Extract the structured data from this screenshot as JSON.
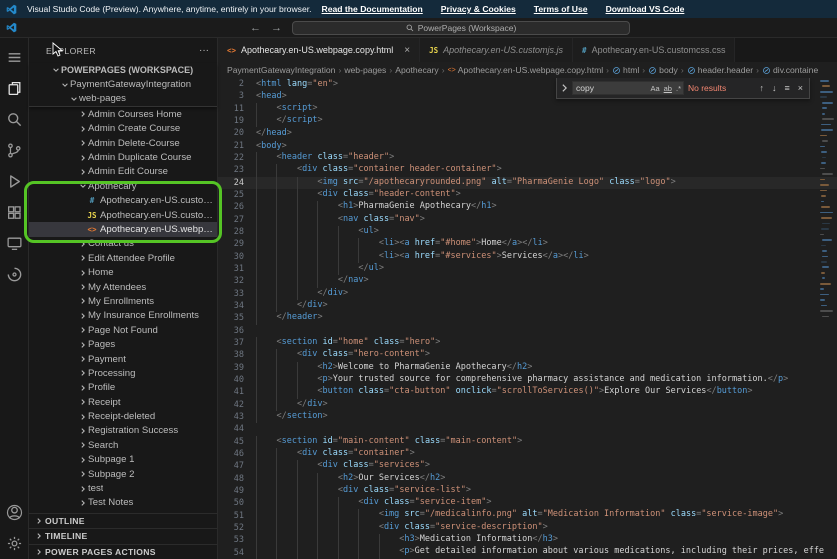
{
  "banner": {
    "text": "Visual Studio Code (Preview). Anywhere, anytime, entirely in your browser.",
    "links": [
      "Read the Documentation",
      "Privacy & Cookies",
      "Terms of Use",
      "Download VS Code"
    ]
  },
  "titlebar": {
    "search_label": "PowerPages (Workspace)",
    "back": "←",
    "forward": "→"
  },
  "activitybar": {
    "icons": [
      "menu-icon",
      "explorer-icon",
      "search-icon",
      "source-control-icon",
      "run-debug-icon",
      "extensions-icon",
      "remote-explorer-icon",
      "power-platform-icon"
    ],
    "bottom_icons": [
      "account-icon",
      "settings-gear-icon"
    ],
    "active": "explorer-icon"
  },
  "sidebar": {
    "title": "EXPLORER",
    "actions_label": "···",
    "sticky": [
      {
        "label": "POWERPAGES (WORKSPACE)",
        "level": 0,
        "expanded": true,
        "bold": true
      },
      {
        "label": "PaymentGatewayIntegration",
        "level": 1,
        "expanded": true
      },
      {
        "label": "web-pages",
        "level": 2,
        "expanded": true
      }
    ],
    "items": [
      {
        "label": "Admin Courses Home",
        "level": 3,
        "kind": "folder"
      },
      {
        "label": "Admin Create Course",
        "level": 3,
        "kind": "folder"
      },
      {
        "label": "Admin Delete-Course",
        "level": 3,
        "kind": "folder"
      },
      {
        "label": "Admin Duplicate Course",
        "level": 3,
        "kind": "folder"
      },
      {
        "label": "Admin Edit Course",
        "level": 3,
        "kind": "folder"
      },
      {
        "label": "Apothecary",
        "level": 3,
        "kind": "folder",
        "expanded": true
      },
      {
        "label": "Apothecary.en-US.customcss.css",
        "level": 4,
        "kind": "css"
      },
      {
        "label": "Apothecary.en-US.customjs.js",
        "level": 4,
        "kind": "js"
      },
      {
        "label": "Apothecary.en-US.webpage.copy.html",
        "level": 4,
        "kind": "html",
        "selected": true
      },
      {
        "label": "Contact us",
        "level": 3,
        "kind": "folder"
      },
      {
        "label": "Edit Attendee Profile",
        "level": 3,
        "kind": "folder"
      },
      {
        "label": "Home",
        "level": 3,
        "kind": "folder"
      },
      {
        "label": "My Attendees",
        "level": 3,
        "kind": "folder"
      },
      {
        "label": "My Enrollments",
        "level": 3,
        "kind": "folder"
      },
      {
        "label": "My Insurance Enrollments",
        "level": 3,
        "kind": "folder"
      },
      {
        "label": "Page Not Found",
        "level": 3,
        "kind": "folder"
      },
      {
        "label": "Pages",
        "level": 3,
        "kind": "folder"
      },
      {
        "label": "Payment",
        "level": 3,
        "kind": "folder"
      },
      {
        "label": "Processing",
        "level": 3,
        "kind": "folder"
      },
      {
        "label": "Profile",
        "level": 3,
        "kind": "folder"
      },
      {
        "label": "Receipt",
        "level": 3,
        "kind": "folder"
      },
      {
        "label": "Receipt-deleted",
        "level": 3,
        "kind": "folder"
      },
      {
        "label": "Registration Success",
        "level": 3,
        "kind": "folder"
      },
      {
        "label": "Search",
        "level": 3,
        "kind": "folder"
      },
      {
        "label": "Subpage 1",
        "level": 3,
        "kind": "folder"
      },
      {
        "label": "Subpage 2",
        "level": 3,
        "kind": "folder"
      },
      {
        "label": "test",
        "level": 3,
        "kind": "folder"
      },
      {
        "label": "Test Notes",
        "level": 3,
        "kind": "folder"
      }
    ],
    "panels": [
      "OUTLINE",
      "TIMELINE",
      "POWER PAGES ACTIONS"
    ]
  },
  "tabs": [
    {
      "label": "Apothecary.en-US.webpage.copy.html",
      "icon": "html",
      "active": true,
      "close_label": "×"
    },
    {
      "label": "Apothecary.en-US.customjs.js",
      "icon": "js",
      "preview": true
    },
    {
      "label": "Apothecary.en-US.customcss.css",
      "icon": "css"
    }
  ],
  "breadcrumbs": [
    {
      "label": "PaymentGatewayIntegration"
    },
    {
      "label": "web-pages"
    },
    {
      "label": "Apothecary"
    },
    {
      "label": "Apothecary.en-US.webpage.copy.html",
      "icon": "html"
    },
    {
      "label": "html",
      "icon": "symbol"
    },
    {
      "label": "body",
      "icon": "symbol"
    },
    {
      "label": "header.header",
      "icon": "symbol"
    },
    {
      "label": "div.containe",
      "icon": "symbol"
    }
  ],
  "find": {
    "query": "copy",
    "status": "No results",
    "options": [
      "Aa",
      "ab",
      ".*"
    ],
    "buttons": [
      "↑",
      "↓",
      "≡",
      "×"
    ]
  },
  "editor": {
    "active_line": 24,
    "lines": [
      {
        "n": 2,
        "t": "<html lang=\"en\">"
      },
      {
        "n": 3,
        "t": "<head>"
      },
      {
        "n": 11,
        "t": "    <script>"
      },
      {
        "n": 19,
        "t": "    </script>"
      },
      {
        "n": 20,
        "t": "</head>"
      },
      {
        "n": 21,
        "t": "<body>"
      },
      {
        "n": 22,
        "t": "    <header class=\"header\">"
      },
      {
        "n": 23,
        "t": "        <div class=\"container header-container\">"
      },
      {
        "n": 24,
        "t": "            <img src=\"/apothecaryrounded.png\" alt=\"PharmaGenie Logo\" class=\"logo\">"
      },
      {
        "n": 25,
        "t": "            <div class=\"header-content\">"
      },
      {
        "n": 26,
        "t": "                <h1>PharmaGenie Apothecary</h1>"
      },
      {
        "n": 27,
        "t": "                <nav class=\"nav\">"
      },
      {
        "n": 28,
        "t": "                    <ul>"
      },
      {
        "n": 29,
        "t": "                        <li><a href=\"#home\">Home</a></li>"
      },
      {
        "n": 30,
        "t": "                        <li><a href=\"#services\">Services</a></li>"
      },
      {
        "n": 31,
        "t": "                    </ul>"
      },
      {
        "n": 32,
        "t": "                </nav>"
      },
      {
        "n": 33,
        "t": "            </div>"
      },
      {
        "n": 34,
        "t": "        </div>"
      },
      {
        "n": 35,
        "t": "    </header>"
      },
      {
        "n": 36,
        "t": ""
      },
      {
        "n": 37,
        "t": "    <section id=\"home\" class=\"hero\">"
      },
      {
        "n": 38,
        "t": "        <div class=\"hero-content\">"
      },
      {
        "n": 39,
        "t": "            <h2>Welcome to PharmaGenie Apothecary</h2>"
      },
      {
        "n": 40,
        "t": "            <p>Your trusted source for comprehensive pharmacy assistance and medication information.</p>"
      },
      {
        "n": 41,
        "t": "            <button class=\"cta-button\" onclick=\"scrollToServices()\">Explore Our Services</button>"
      },
      {
        "n": 42,
        "t": "        </div>"
      },
      {
        "n": 43,
        "t": "    </section>"
      },
      {
        "n": 44,
        "t": ""
      },
      {
        "n": 45,
        "t": "    <section id=\"main-content\" class=\"main-content\">"
      },
      {
        "n": 46,
        "t": "        <div class=\"container\">"
      },
      {
        "n": 47,
        "t": "            <div class=\"services\">"
      },
      {
        "n": 48,
        "t": "                <h2>Our Services</h2>"
      },
      {
        "n": 49,
        "t": "                <div class=\"service-list\">"
      },
      {
        "n": 50,
        "t": "                    <div class=\"service-item\">"
      },
      {
        "n": 51,
        "t": "                        <img src=\"/medicalinfo.png\" alt=\"Medication Information\" class=\"service-image\">"
      },
      {
        "n": 52,
        "t": "                        <div class=\"service-description\">"
      },
      {
        "n": 53,
        "t": "                            <h3>Medication Information</h3>"
      },
      {
        "n": 54,
        "t": "                            <p>Get detailed information about various medications, including their prices, effe"
      }
    ]
  },
  "colors": {
    "annotation_green": "#55c425",
    "error_red": "#f48771",
    "html_icon": "#e37933",
    "js_icon": "#e8d44d",
    "css_icon": "#519aba",
    "banner_bg": "#142a3b"
  }
}
